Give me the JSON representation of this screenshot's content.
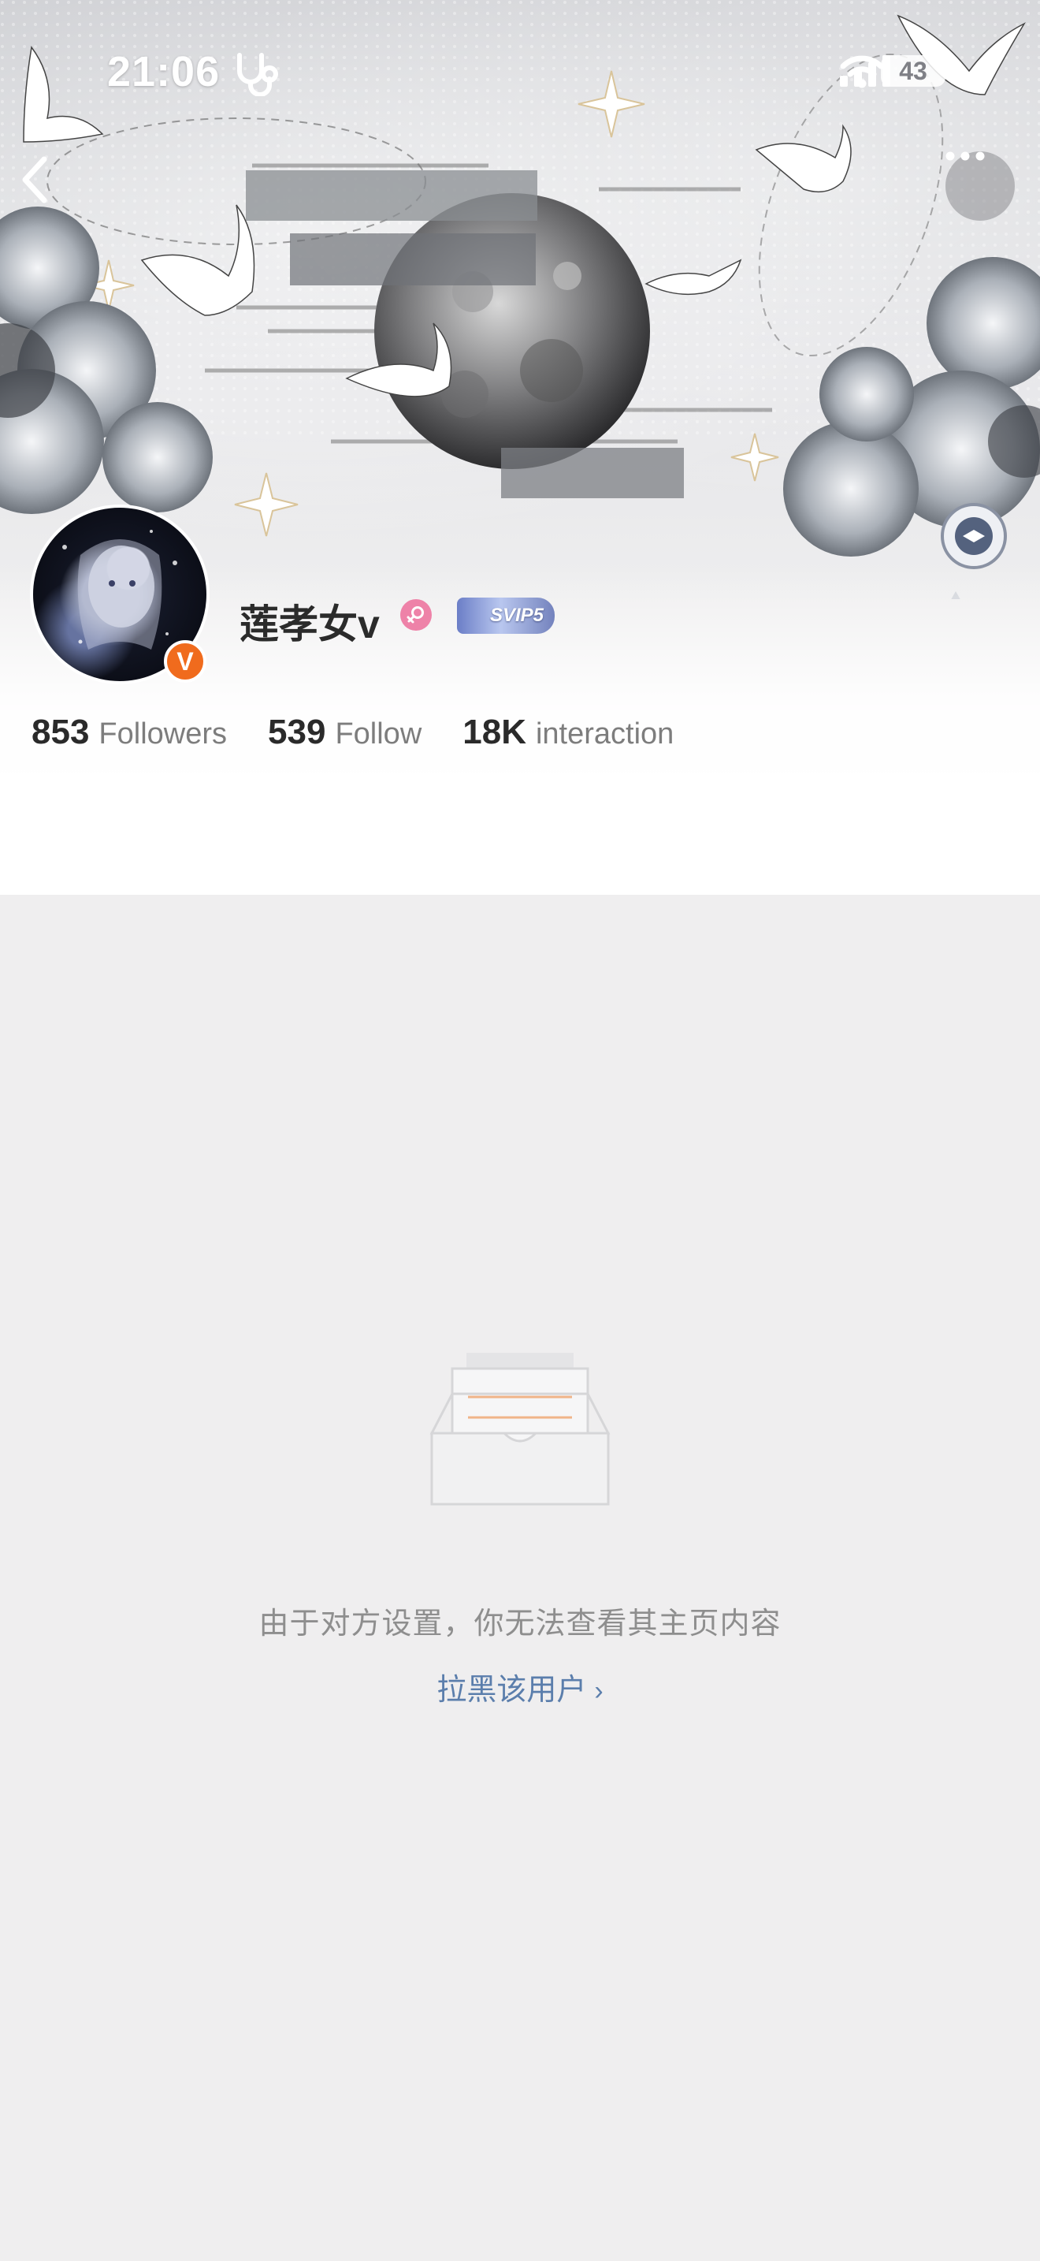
{
  "status_bar": {
    "time": "21:06",
    "battery": "43"
  },
  "profile": {
    "username": "莲孝女v",
    "vip_badge": "SVIP5",
    "verified_badge": "V",
    "stats": [
      {
        "value": "853",
        "label": "Followers"
      },
      {
        "value": "539",
        "label": "Follow"
      },
      {
        "value": "18K",
        "label": "interaction"
      }
    ]
  },
  "empty_state": {
    "message": "由于对方设置，你无法查看其主页内容",
    "block_link": "拉黑该用户"
  },
  "icons": {
    "back": "chevron-left-icon",
    "more": "more-horizontal-icon",
    "gender": "female-icon",
    "empty": "empty-inbox-icon"
  },
  "colors": {
    "accent_orange": "#f06b1d",
    "link_blue": "#5b7eac",
    "gender_pink": "#ee82a8"
  }
}
